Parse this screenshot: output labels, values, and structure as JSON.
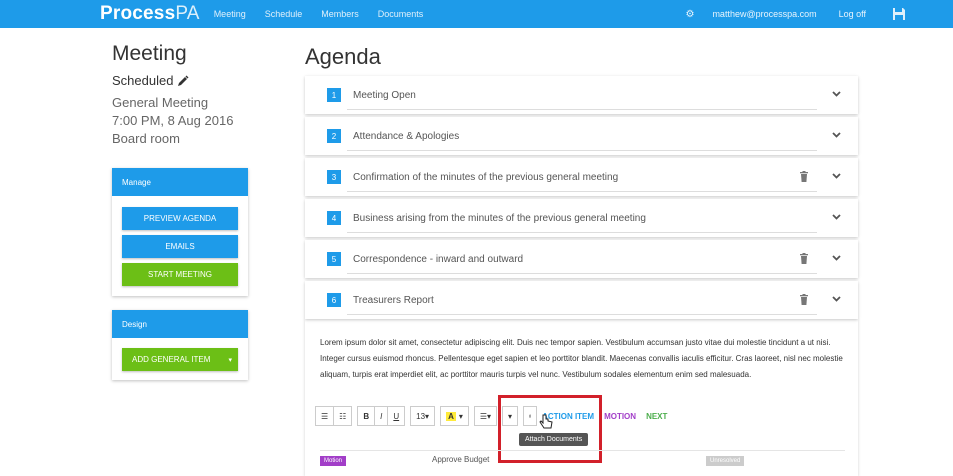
{
  "app": {
    "logo_main": "Process",
    "logo_suffix": "PA",
    "nav": [
      "Meeting",
      "Schedule",
      "Members",
      "Documents"
    ],
    "user_email": "matthew@processpa.com",
    "logoff_label": "Log off"
  },
  "meeting": {
    "title": "Meeting",
    "status": "Scheduled",
    "type": "General Meeting",
    "datetime": "7:00 PM, 8 Aug 2016",
    "location": "Board room"
  },
  "manage": {
    "header": "Manage",
    "preview_label": "PREVIEW AGENDA",
    "emails_label": "EMAILS",
    "start_label": "START MEETING"
  },
  "design": {
    "header": "Design",
    "add_item_label": "ADD GENERAL ITEM"
  },
  "agenda": {
    "title": "Agenda",
    "items": [
      {
        "num": "1",
        "title": "Meeting Open"
      },
      {
        "num": "2",
        "title": "Attendance & Apologies"
      },
      {
        "num": "3",
        "title": "Confirmation of the minutes of the previous general meeting"
      },
      {
        "num": "4",
        "title": "Business arising from the minutes of the previous general meeting"
      },
      {
        "num": "5",
        "title": "Correspondence - inward and outward"
      },
      {
        "num": "6",
        "title": "Treasurers Report"
      }
    ]
  },
  "editor": {
    "body_text": "Lorem ipsum dolor sit amet, consectetur adipiscing elit. Duis nec tempor sapien. Vestibulum accumsan justo vitae dui molestie tincidunt a ut nisi. Integer cursus euismod rhoncus. Pellentesque eget sapien et leo porttitor blandit. Maecenas convallis iaculis efficitur. Cras laoreet, nisl nec molestie aliquam, turpis erat imperdiet elit, ac porttitor mauris turpis vel nunc. Vestibulum sodales elementum enim sed malesuada.",
    "font_size": "13",
    "bold": "B",
    "italic": "I",
    "underline": "U",
    "highlight": "A",
    "action_item_label": "ACTION ITEM",
    "motion_label": "MOTION",
    "next_label": "NEXT",
    "tooltip": "Attach Documents"
  },
  "motion": {
    "badge": "Motion",
    "text": "Approve Budget",
    "status": "Unresolved"
  },
  "colors": {
    "brand_blue": "#1e9be9",
    "start_green": "#6cbf16",
    "motion_purple": "#a23ec8",
    "next_green": "#4cae4c",
    "highlight_red": "#d2202a"
  }
}
